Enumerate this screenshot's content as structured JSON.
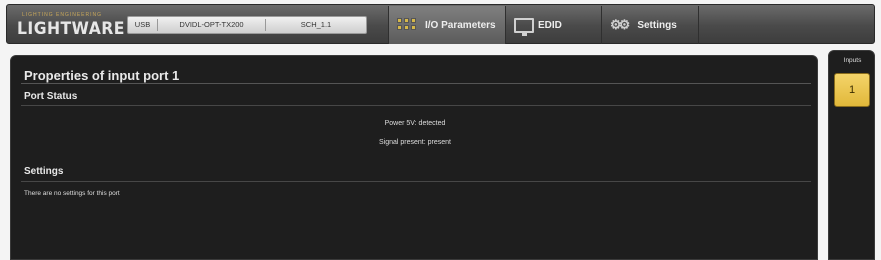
{
  "brand": {
    "tagline": "LIGHTING ENGINEERING",
    "name": "LIGHTWARE"
  },
  "connection": {
    "interface": "USB",
    "device": "DVIDL-OPT-TX200",
    "firmware": "SCH_1.1"
  },
  "tabs": [
    {
      "label": "I/O Parameters",
      "icon": "io-ports-icon",
      "active": true
    },
    {
      "label": "EDID",
      "icon": "monitor-icon",
      "active": false
    },
    {
      "label": "Settings",
      "icon": "gears-icon",
      "active": false
    }
  ],
  "panel": {
    "title": "Properties of input port 1",
    "port_status": {
      "heading": "Port Status",
      "power": "Power 5V: detected",
      "signal": "Signal present: present"
    },
    "settings": {
      "heading": "Settings",
      "note": "There are no settings for this port"
    }
  },
  "inputs": {
    "label": "Inputs",
    "ports": [
      "1"
    ],
    "selected": "1"
  },
  "colors": {
    "accent": "#e8c24f",
    "panel_bg": "#1e1e1e",
    "topbar": "#4a4a4a"
  }
}
